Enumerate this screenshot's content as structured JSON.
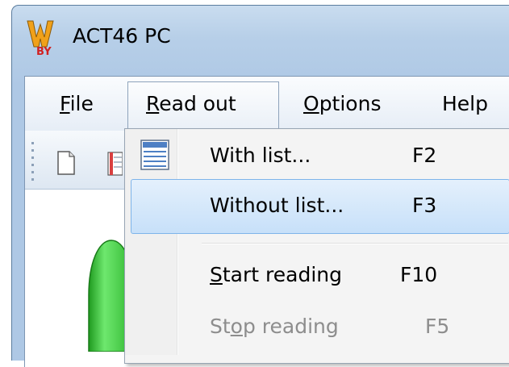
{
  "window": {
    "title": "ACT46 PC"
  },
  "menubar": {
    "items": [
      {
        "before": "",
        "acc": "F",
        "after": "ile"
      },
      {
        "before": "",
        "acc": "R",
        "after": "ead out"
      },
      {
        "before": "",
        "acc": "O",
        "after": "ptions"
      },
      {
        "before": "Help",
        "acc": "",
        "after": ""
      }
    ]
  },
  "dropdown": {
    "items": [
      {
        "before": "With list...",
        "acc": "",
        "after": "",
        "shortcut": "F2",
        "state": "normal"
      },
      {
        "before": "Without list...",
        "acc": "",
        "after": "",
        "shortcut": "F3",
        "state": "highlighted"
      },
      {
        "before": "",
        "acc": "S",
        "after": "tart reading",
        "shortcut": "F10",
        "state": "normal"
      },
      {
        "before": "St",
        "acc": "o",
        "after": "p reading",
        "shortcut": "F5",
        "state": "disabled"
      }
    ]
  },
  "colors": {
    "highlight": "#c7e0f9",
    "highlight_border": "#7eb4ea",
    "disabled_text": "#8d8d8d",
    "title_bar": "#b7cfe8",
    "status_indicator": "#33cc33"
  },
  "icons": {
    "app": "app-logo-icon",
    "toolbar": [
      "new-document-icon",
      "list-icon"
    ],
    "menu": "list-icon",
    "status": "green-indicator-icon"
  }
}
